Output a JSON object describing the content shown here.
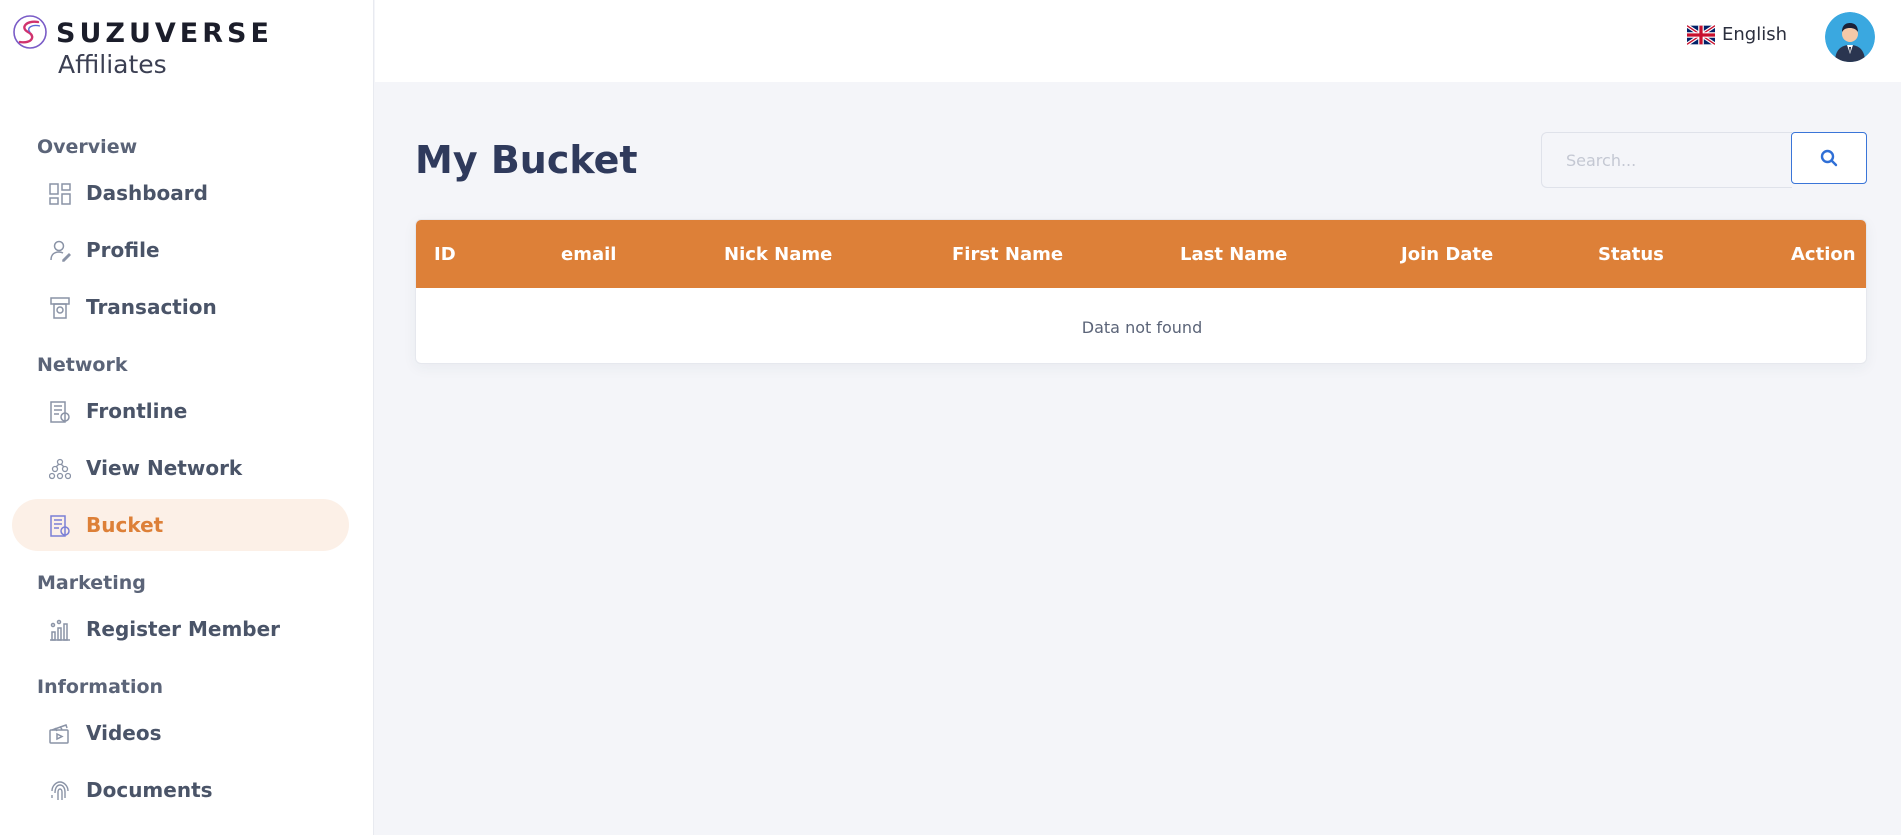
{
  "brand": {
    "name": "SUZUVERSE",
    "subtitle": "Affiliates"
  },
  "sidebar": {
    "sections": [
      {
        "title": "Overview",
        "items": [
          {
            "label": "Dashboard",
            "icon": "dashboard-icon"
          },
          {
            "label": "Profile",
            "icon": "user-edit-icon"
          },
          {
            "label": "Transaction",
            "icon": "transaction-icon"
          }
        ]
      },
      {
        "title": "Network",
        "items": [
          {
            "label": "Frontline",
            "icon": "frontline-icon"
          },
          {
            "label": "View Network",
            "icon": "network-icon"
          },
          {
            "label": "Bucket",
            "icon": "bucket-icon",
            "active": true
          }
        ]
      },
      {
        "title": "Marketing",
        "items": [
          {
            "label": "Register Member",
            "icon": "chart-icon"
          }
        ]
      },
      {
        "title": "Information",
        "items": [
          {
            "label": "Videos",
            "icon": "video-icon"
          },
          {
            "label": "Documents",
            "icon": "fingerprint-icon"
          }
        ]
      }
    ]
  },
  "topbar": {
    "language": "English",
    "language_icon": "uk-flag-icon",
    "avatar_icon": "avatar-icon"
  },
  "main": {
    "title": "My Bucket",
    "search": {
      "placeholder": "Search...",
      "value": ""
    },
    "table": {
      "columns": [
        "ID",
        "email",
        "Nick Name",
        "First Name",
        "Last Name",
        "Join Date",
        "Status",
        "Action"
      ],
      "rows": [],
      "empty_message": "Data not found"
    }
  },
  "colors": {
    "accent": "#dd8038",
    "active_bg": "#fcf0e7",
    "title": "#2f3a5c",
    "search_border": "#3a75d8"
  }
}
